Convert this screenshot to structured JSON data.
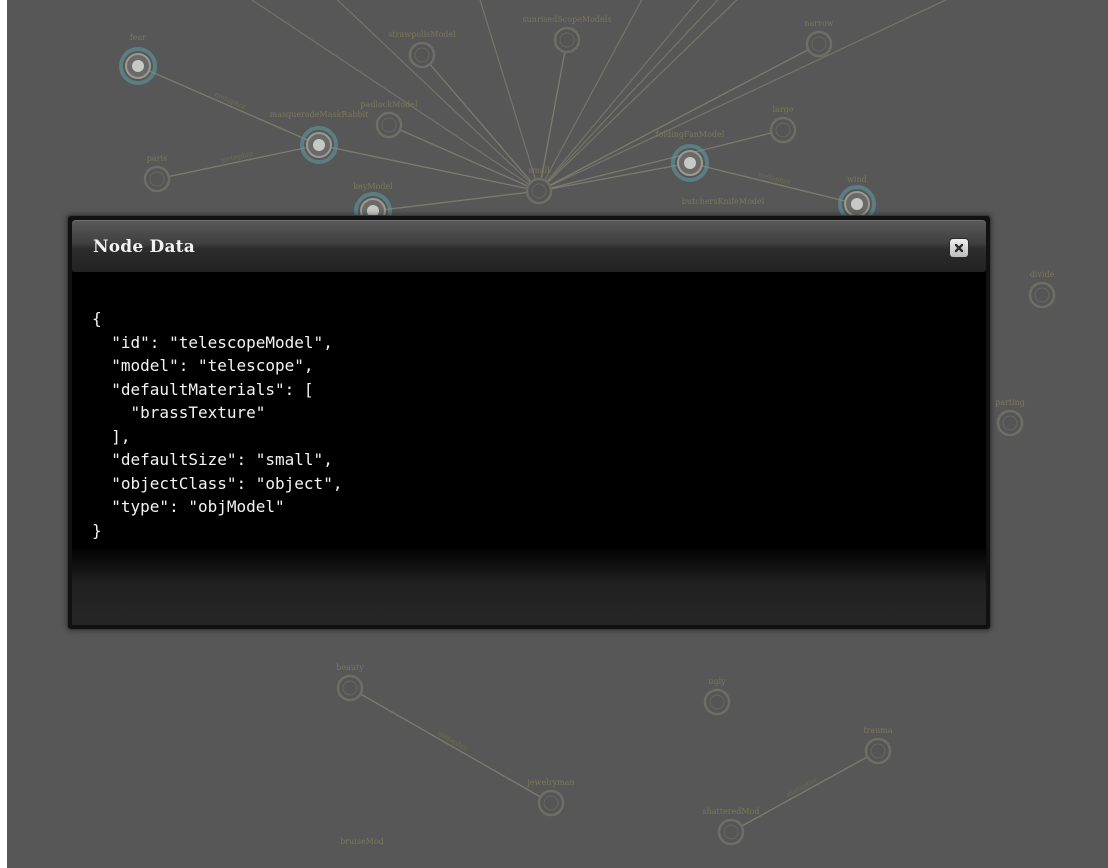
{
  "background_graph": {
    "nodes": [
      {
        "id": "fear",
        "label": "fear"
      },
      {
        "id": "strawpollsModel",
        "label": "strawpollsModel"
      },
      {
        "id": "sunrisedScopeModels",
        "label": "sunrisedScopeModels"
      },
      {
        "id": "narrow",
        "label": "narrow"
      },
      {
        "id": "masqueradeMaskRabbit",
        "label": "masqueradeMaskRabbit"
      },
      {
        "id": "padlockModel",
        "label": "padlockModel"
      },
      {
        "id": "large",
        "label": "large"
      },
      {
        "id": "paris",
        "label": "paris"
      },
      {
        "id": "foldingFanModel",
        "label": "foldingFanModel"
      },
      {
        "id": "small",
        "label": "small"
      },
      {
        "id": "keyModel",
        "label": "keyModel"
      },
      {
        "id": "wind",
        "label": "wind"
      },
      {
        "id": "butchersKnifeModel",
        "label": "butchersKnifeModel"
      },
      {
        "id": "divide",
        "label": "divide"
      },
      {
        "id": "parting",
        "label": "parting"
      },
      {
        "id": "beauty",
        "label": "beauty"
      },
      {
        "id": "ugly",
        "label": "ugly"
      },
      {
        "id": "trauma",
        "label": "trauma"
      },
      {
        "id": "jewelryman",
        "label": "jewelryman"
      },
      {
        "id": "shatteredMod",
        "label": "shatteredMod"
      },
      {
        "id": "bruiseMod",
        "label": "bruiseMod"
      }
    ],
    "edge_label": "metaphor"
  },
  "dialog": {
    "title": "Node Data",
    "close_icon": "close-x-icon",
    "json_text": "{\n  \"id\": \"telescopeModel\",\n  \"model\": \"telescope\",\n  \"defaultMaterials\": [\n    \"brassTexture\"\n  ],\n  \"defaultSize\": \"small\",\n  \"objectClass\": \"object\",\n  \"type\": \"objModel\"\n}"
  },
  "colors": {
    "backdrop": "#575757",
    "node_ring": "#6e6e66",
    "node_highlight": "#5f9ea8",
    "edge": "#8a8878",
    "dialog_body": "#000000",
    "dialog_text": "#f4f4f4"
  }
}
